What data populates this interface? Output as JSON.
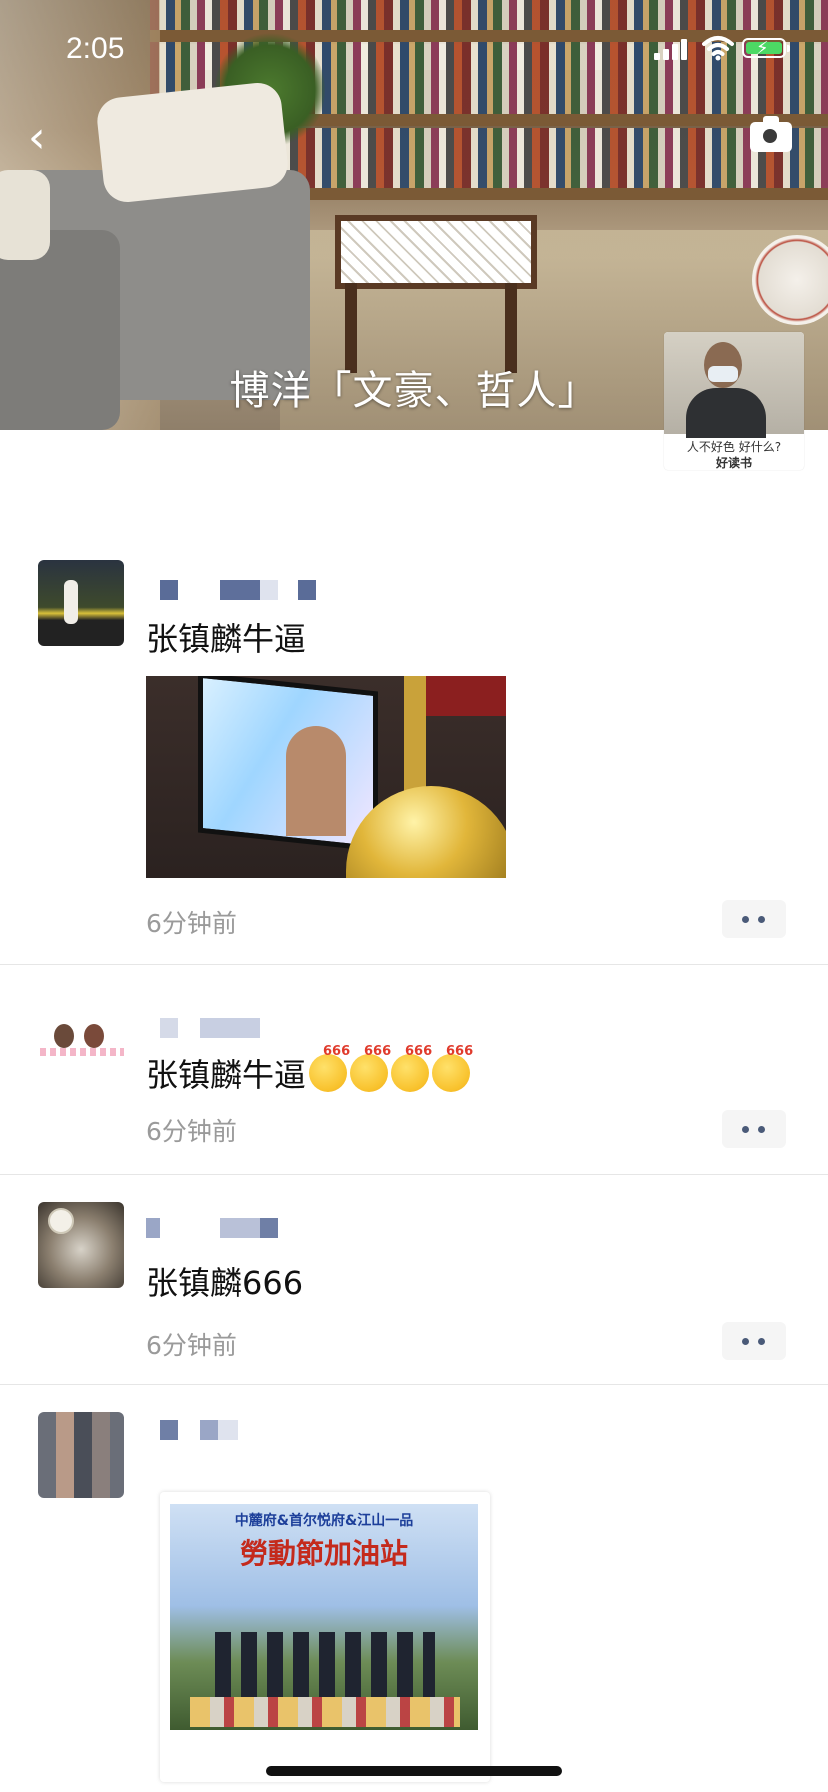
{
  "status_bar": {
    "time": "2:05"
  },
  "cover": {
    "title": "博洋「文豪、哲人」",
    "avatar_caption_line1": "人不好色 好什么?",
    "avatar_caption_line2": "好读书"
  },
  "posts": [
    {
      "text": "张镇麟牛逼",
      "time": "6分钟前",
      "has_image": true
    },
    {
      "text": "张镇麟牛逼",
      "emoji_count": 4,
      "emoji_label": "666",
      "time": "6分钟前"
    },
    {
      "text": "张镇麟666",
      "time": "6分钟前"
    },
    {
      "has_image": true,
      "image_text_line1": "中麓府&首尔悦府&江山一品",
      "image_text_line2": "勞動節加油站"
    }
  ],
  "icons": [
    "back-arrow-icon",
    "camera-icon",
    "more-dots-icon",
    "signal-icon",
    "wifi-icon",
    "battery-icon"
  ],
  "colors": {
    "link_name": "#576b95",
    "time_gray": "#9a9a9a",
    "more_bg": "#f5f5f5"
  }
}
